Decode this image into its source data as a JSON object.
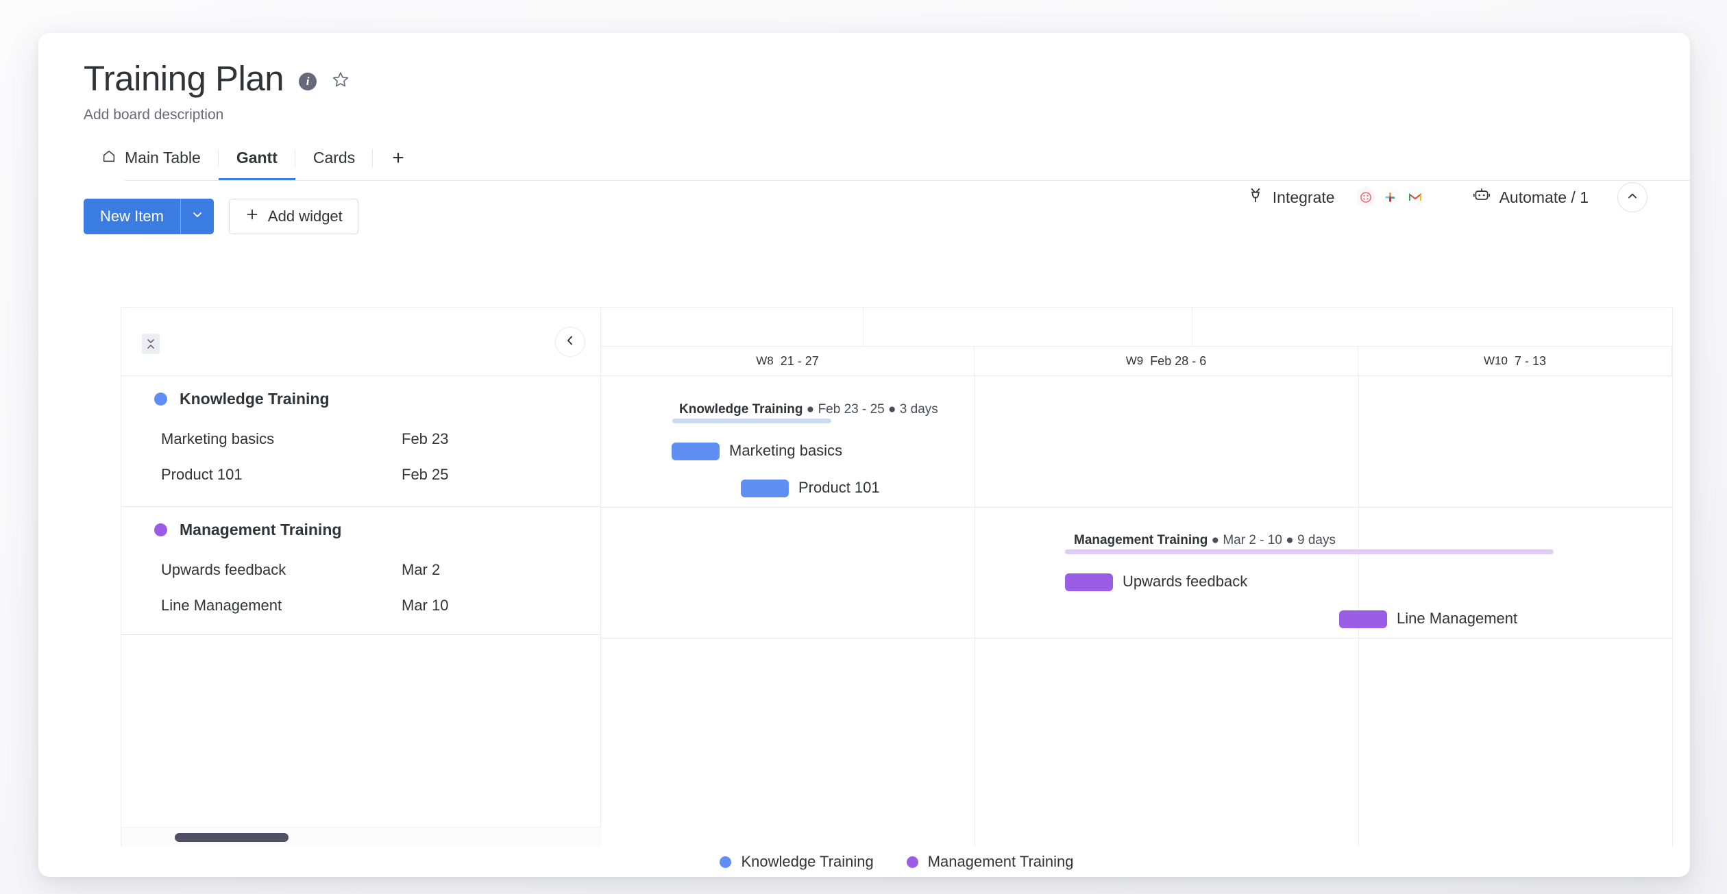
{
  "board": {
    "title": "Training Plan",
    "description": "Add board description",
    "info_icon": "info-icon",
    "star_icon": "star-icon"
  },
  "tabs": [
    {
      "label": "Main Table",
      "icon": "home-icon",
      "active": false
    },
    {
      "label": "Gantt",
      "icon": "",
      "active": true
    },
    {
      "label": "Cards",
      "icon": "",
      "active": false
    }
  ],
  "tab_add_label": "+",
  "header_tools": {
    "integrate_label": "Integrate",
    "integrate_icon": "integrate-plug-icon",
    "integration_apps": [
      "mailchimp-icon",
      "slack-icon",
      "gmail-icon"
    ],
    "automate_label": "Automate / 1",
    "automate_icon": "robot-icon",
    "collapse_icon": "chevron-up-icon"
  },
  "action_bar": {
    "new_item_label": "New Item",
    "new_item_caret": "chevron-down-icon",
    "add_widget_label": "Add widget",
    "add_widget_icon": "plus-icon"
  },
  "gantt": {
    "collapse_rows_icon": "collapse-rows-icon",
    "prev_icon": "chevron-left-icon",
    "weeks": [
      {
        "week": "W8",
        "range": "21 - 27"
      },
      {
        "week": "W9",
        "range": "Feb 28 - 6"
      },
      {
        "week": "W10",
        "range": "7 - 13"
      }
    ],
    "groups": [
      {
        "name": "Knowledge Training",
        "color": "#5f8ff2",
        "bar_color": "#c9daf9",
        "summary": {
          "name": "Knowledge Training",
          "range": "Feb 23 - 25",
          "duration": "3 days"
        },
        "tasks": [
          {
            "name": "Marketing basics",
            "date": "Feb 23"
          },
          {
            "name": "Product 101",
            "date": "Feb 25"
          }
        ]
      },
      {
        "name": "Management Training",
        "color": "#9b5de5",
        "bar_color": "#dfcdf4",
        "summary": {
          "name": "Management Training",
          "range": "Mar 2 - 10",
          "duration": "9 days"
        },
        "tasks": [
          {
            "name": "Upwards feedback",
            "date": "Mar 2"
          },
          {
            "name": "Line Management",
            "date": "Mar 10"
          }
        ]
      }
    ]
  },
  "legend": [
    {
      "label": "Knowledge Training",
      "color": "#5f8ff2"
    },
    {
      "label": "Management Training",
      "color": "#9b5de5"
    }
  ],
  "chart_data": {
    "type": "bar",
    "title": "Training Plan Gantt",
    "xlabel": "",
    "ylabel": "",
    "axis_ticks": [
      "W8  21 - 27",
      "W9  Feb 28 - 6",
      "W10  7 - 13"
    ],
    "series": [
      {
        "name": "Knowledge Training",
        "color": "#5f8ff2",
        "summary_range": "Feb 23 - 25",
        "summary_duration_days": 3,
        "values": [
          {
            "task": "Marketing basics",
            "start": "Feb 23",
            "end": "Feb 23",
            "days": 1
          },
          {
            "task": "Product 101",
            "start": "Feb 25",
            "end": "Feb 25",
            "days": 1
          }
        ]
      },
      {
        "name": "Management Training",
        "color": "#9b5de5",
        "summary_range": "Mar 2 - 10",
        "summary_duration_days": 9,
        "values": [
          {
            "task": "Upwards feedback",
            "start": "Mar 2",
            "end": "Mar 2",
            "days": 1
          },
          {
            "task": "Line Management",
            "start": "Mar 10",
            "end": "Mar 10",
            "days": 1
          }
        ]
      }
    ],
    "legend_position": "bottom",
    "grid": true
  }
}
